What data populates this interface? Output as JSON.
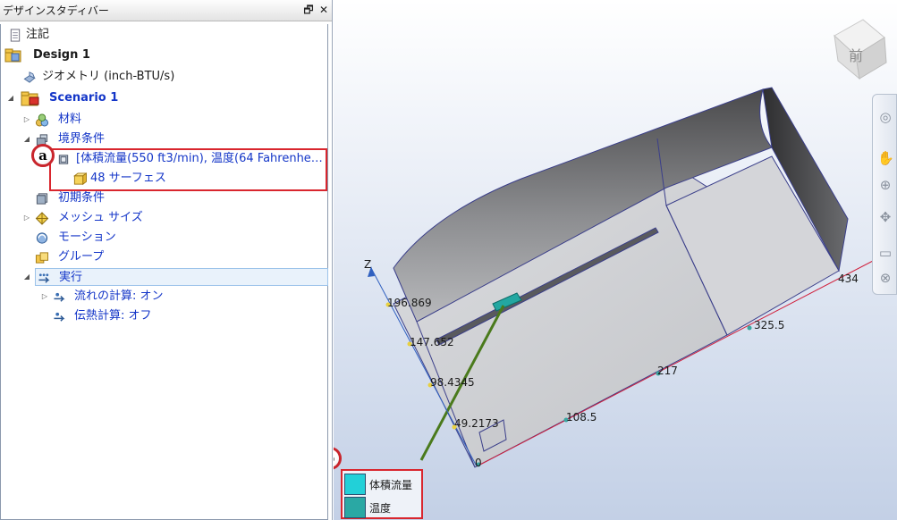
{
  "panel": {
    "title": "デザインスタディバー",
    "pin_glyph": "🗗",
    "close_glyph": "✕"
  },
  "tree": {
    "notes": "注記",
    "design": "Design 1",
    "geometry": "ジオメトリ (inch-BTU/s)",
    "scenario": "Scenario 1",
    "materials": "材料",
    "boundary": "境界条件",
    "bc_item": "[体積流量(550 ft3/min), 温度(64 Fahrenhe…",
    "surfaces": "48 サーフェス",
    "initial": "初期条件",
    "mesh": "メッシュ サイズ",
    "motion": "モーション",
    "groups": "グループ",
    "run": "実行",
    "flow": "流れの計算: オン",
    "heat": "伝熱計算: オフ"
  },
  "callouts": {
    "a": "a",
    "b": "b"
  },
  "viewport": {
    "viewcube_label": "前",
    "axis_z": "Z",
    "z_ticks": [
      "196.869",
      "147.652",
      "98.4345",
      "49.2173"
    ],
    "x_ticks": [
      "0",
      "108.5",
      "217",
      "325.5",
      "434"
    ],
    "legend": [
      {
        "label": "体積流量",
        "color": "#22d0d8"
      },
      {
        "label": "温度",
        "color": "#2aa8a4"
      }
    ]
  },
  "colors": {
    "callout_red": "#d9262e",
    "tree_blue": "#1436c8",
    "leader_green": "#4a7a1c"
  }
}
